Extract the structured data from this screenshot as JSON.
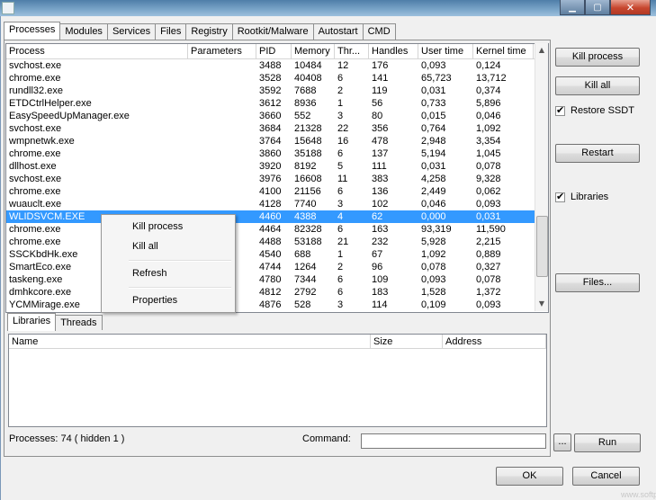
{
  "window": {
    "minimize_glyph": "▁",
    "maximize_glyph": "▢",
    "close_glyph": "✕"
  },
  "tabs": [
    "Processes",
    "Modules",
    "Services",
    "Files",
    "Registry",
    "Rootkit/Malware",
    "Autostart",
    "CMD"
  ],
  "process_table": {
    "headers": [
      "Process",
      "Parameters",
      "PID",
      "Memory",
      "Thr...",
      "Handles",
      "User time",
      "Kernel time"
    ],
    "rows": [
      [
        "svchost.exe",
        "",
        "3488",
        "10484",
        "12",
        "176",
        "0,093",
        "0,124"
      ],
      [
        "chrome.exe",
        "",
        "3528",
        "40408",
        "6",
        "141",
        "65,723",
        "13,712"
      ],
      [
        "rundll32.exe",
        "",
        "3592",
        "7688",
        "2",
        "119",
        "0,031",
        "0,374"
      ],
      [
        "ETDCtrlHelper.exe",
        "",
        "3612",
        "8936",
        "1",
        "56",
        "0,733",
        "5,896"
      ],
      [
        "EasySpeedUpManager.exe",
        "",
        "3660",
        "552",
        "3",
        "80",
        "0,015",
        "0,046"
      ],
      [
        "svchost.exe",
        "",
        "3684",
        "21328",
        "22",
        "356",
        "0,764",
        "1,092"
      ],
      [
        "wmpnetwk.exe",
        "",
        "3764",
        "15648",
        "16",
        "478",
        "2,948",
        "3,354"
      ],
      [
        "chrome.exe",
        "",
        "3860",
        "35188",
        "6",
        "137",
        "5,194",
        "1,045"
      ],
      [
        "dllhost.exe",
        "",
        "3920",
        "8192",
        "5",
        "111",
        "0,031",
        "0,078"
      ],
      [
        "svchost.exe",
        "",
        "3976",
        "16608",
        "11",
        "383",
        "4,258",
        "9,328"
      ],
      [
        "chrome.exe",
        "",
        "4100",
        "21156",
        "6",
        "136",
        "2,449",
        "0,062"
      ],
      [
        "wuauclt.exe",
        "",
        "4128",
        "7740",
        "3",
        "102",
        "0,046",
        "0,093"
      ],
      [
        "WLIDSVCM.EXE",
        "",
        "4460",
        "4388",
        "4",
        "62",
        "0,000",
        "0,031"
      ],
      [
        "chrome.exe",
        "",
        "4464",
        "82328",
        "6",
        "163",
        "93,319",
        "11,590"
      ],
      [
        "chrome.exe",
        "",
        "4488",
        "53188",
        "21",
        "232",
        "5,928",
        "2,215"
      ],
      [
        "SSCKbdHk.exe",
        "",
        "4540",
        "688",
        "1",
        "67",
        "1,092",
        "0,889"
      ],
      [
        "SmartEco.exe",
        "",
        "4744",
        "1264",
        "2",
        "96",
        "0,078",
        "0,327"
      ],
      [
        "taskeng.exe",
        "",
        "4780",
        "7344",
        "6",
        "109",
        "0,093",
        "0,078"
      ],
      [
        "dmhkcore.exe",
        "",
        "4812",
        "2792",
        "6",
        "183",
        "1,528",
        "1,372"
      ],
      [
        "YCMMirage.exe",
        "",
        "4876",
        "528",
        "3",
        "114",
        "0,109",
        "0,093"
      ]
    ],
    "selected_row": 12
  },
  "context_menu": [
    "Kill process",
    "Kill all",
    "Refresh",
    "Properties"
  ],
  "right_panel": {
    "kill_process": "Kill process",
    "kill_all": "Kill all",
    "restore_ssdt": "Restore SSDT",
    "restart": "Restart",
    "libraries": "Libraries",
    "files": "Files...",
    "check_mark": "✔"
  },
  "bottom_tabs": [
    "Libraries",
    "Threads"
  ],
  "library_table": {
    "headers": [
      "Name",
      "Size",
      "Address"
    ]
  },
  "status": "Processes: 74  ( hidden 1 )",
  "command_label": "Command:",
  "buttons": {
    "browse": "...",
    "run": "Run",
    "ok": "OK",
    "cancel": "Cancel"
  },
  "scroll": {
    "up": "▲",
    "down": "▼"
  },
  "watermark": "www.softpedia..."
}
